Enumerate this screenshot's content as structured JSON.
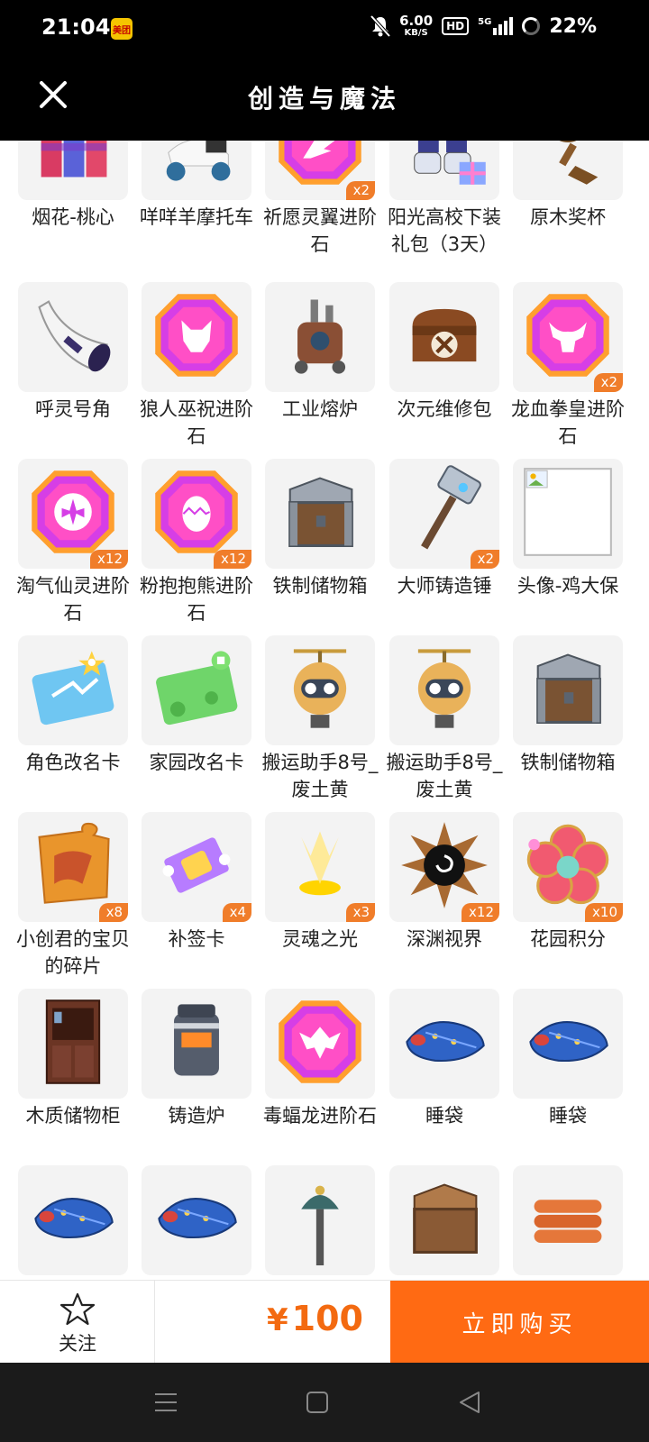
{
  "status_bar": {
    "time": "21:04",
    "app_badge": "美团",
    "net_speed": "6.00",
    "net_unit": "KB/S",
    "hd": "HD",
    "signal": "5G",
    "battery": "22%"
  },
  "header": {
    "title": "创造与魔法"
  },
  "colors": {
    "accent": "#ff6a13",
    "price": "#f36a11",
    "badge": "#f07d2a"
  },
  "items": [
    {
      "name": "烟花-桃心",
      "qty": "",
      "icon": "firework-rocket-icon"
    },
    {
      "name": "咩咩羊摩托车",
      "qty": "",
      "icon": "sheep-scooter-icon"
    },
    {
      "name": "祈愿灵翼进阶石",
      "qty": "x2",
      "icon": "wing-gem-icon"
    },
    {
      "name": "阳光高校下装礼包（3天）",
      "qty": "",
      "icon": "school-pants-gift-icon"
    },
    {
      "name": "原木奖杯",
      "qty": "",
      "icon": "wooden-trophy-icon"
    },
    {
      "name": "呼灵号角",
      "qty": "",
      "icon": "horn-icon"
    },
    {
      "name": "狼人巫祝进阶石",
      "qty": "",
      "icon": "wolf-gem-icon"
    },
    {
      "name": "工业熔炉",
      "qty": "",
      "icon": "industrial-furnace-icon"
    },
    {
      "name": "次元维修包",
      "qty": "",
      "icon": "repair-bag-icon"
    },
    {
      "name": "龙血拳皇进阶石",
      "qty": "x2",
      "icon": "bull-gem-icon"
    },
    {
      "name": "淘气仙灵进阶石",
      "qty": "x12",
      "icon": "fairy-gem-icon"
    },
    {
      "name": "粉抱抱熊进阶石",
      "qty": "x12",
      "icon": "egg-gem-icon"
    },
    {
      "name": "铁制储物箱",
      "qty": "",
      "icon": "iron-chest-icon"
    },
    {
      "name": "大师铸造锤",
      "qty": "x2",
      "icon": "forge-hammer-icon"
    },
    {
      "name": "头像-鸡大保",
      "qty": "",
      "icon": "broken-image-icon"
    },
    {
      "name": "角色改名卡",
      "qty": "",
      "icon": "blue-rename-card-icon"
    },
    {
      "name": "家园改名卡",
      "qty": "",
      "icon": "green-rename-card-icon"
    },
    {
      "name": "搬运助手8号_废土黄",
      "qty": "",
      "icon": "robot-yellow-icon"
    },
    {
      "name": "搬运助手8号_废土黄",
      "qty": "",
      "icon": "robot-yellow-icon"
    },
    {
      "name": "铁制储物箱",
      "qty": "",
      "icon": "iron-chest-icon"
    },
    {
      "name": "小创君的宝贝的碎片",
      "qty": "x8",
      "icon": "puzzle-piece-icon"
    },
    {
      "name": "补签卡",
      "qty": "x4",
      "icon": "signin-ticket-icon"
    },
    {
      "name": "灵魂之光",
      "qty": "x3",
      "icon": "soul-light-icon"
    },
    {
      "name": "深渊视界",
      "qty": "x12",
      "icon": "abyss-eye-icon"
    },
    {
      "name": "花园积分",
      "qty": "x10",
      "icon": "flower-token-icon"
    },
    {
      "name": "木质储物柜",
      "qty": "",
      "icon": "wooden-cabinet-icon"
    },
    {
      "name": "铸造炉",
      "qty": "",
      "icon": "forge-furnace-icon"
    },
    {
      "name": "毒蝠龙进阶石",
      "qty": "",
      "icon": "bat-dragon-gem-icon"
    },
    {
      "name": "睡袋",
      "qty": "",
      "icon": "sleeping-bag-icon"
    },
    {
      "name": "睡袋",
      "qty": "",
      "icon": "sleeping-bag-icon"
    },
    {
      "name": "",
      "qty": "",
      "icon": "sleeping-bag-icon"
    },
    {
      "name": "",
      "qty": "",
      "icon": "sleeping-bag-icon"
    },
    {
      "name": "",
      "qty": "",
      "icon": "lamp-post-icon"
    },
    {
      "name": "",
      "qty": "",
      "icon": "wooden-chest-icon"
    },
    {
      "name": "",
      "qty": "",
      "icon": "log-pile-icon"
    }
  ],
  "buy_bar": {
    "follow_label": "关注",
    "price_symbol": "¥",
    "price": "100",
    "buy_label": "立即购买"
  }
}
